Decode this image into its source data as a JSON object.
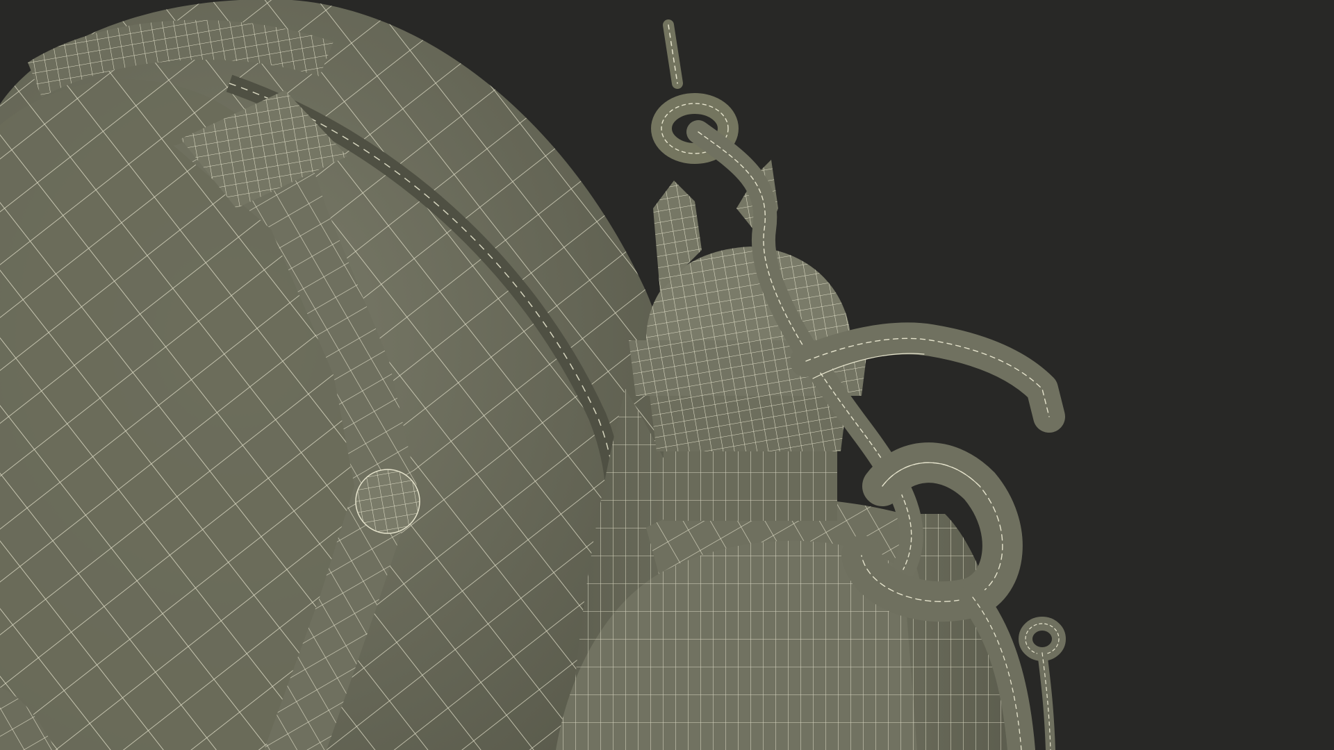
{
  "scene": {
    "background": "#282826",
    "surface_color": "#6f705f",
    "surface_shadow": "#595a4b",
    "wire_color": "#e6e4cd",
    "objects": [
      "large-padded-tank",
      "strap-with-rivet",
      "valve-cap",
      "bell-neck",
      "rope-knot",
      "hose-loop",
      "hanging-cord"
    ]
  }
}
